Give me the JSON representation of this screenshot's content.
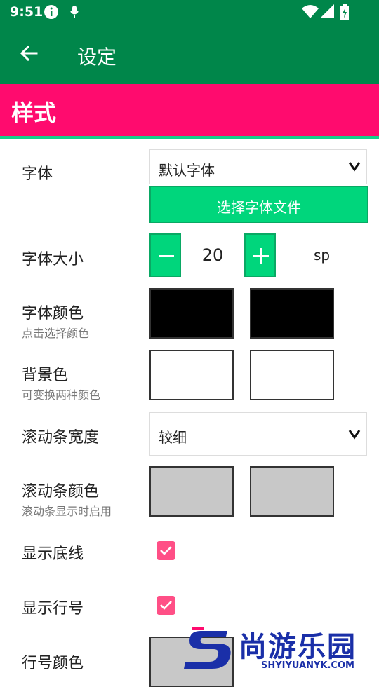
{
  "status_bar": {
    "time": "9:51"
  },
  "app_bar": {
    "title": "设定"
  },
  "section": {
    "title": "样式"
  },
  "font": {
    "label": "字体",
    "select_value": "默认字体",
    "choose_button": "选择字体文件"
  },
  "font_size": {
    "label": "字体大小",
    "value": "20",
    "unit": "sp"
  },
  "font_color": {
    "label": "字体颜色",
    "sublabel": "点击选择颜色",
    "colors": [
      "#000000",
      "#000000"
    ]
  },
  "bg_color": {
    "label": "背景色",
    "sublabel": "可变换两种颜色",
    "colors": [
      "#ffffff",
      "#ffffff"
    ]
  },
  "scrollbar_width": {
    "label": "滚动条宽度",
    "select_value": "较细"
  },
  "scrollbar_color": {
    "label": "滚动条颜色",
    "sublabel": "滚动条显示时启用",
    "colors": [
      "#c8c8c8",
      "#c8c8c8"
    ]
  },
  "show_underline": {
    "label": "显示底线",
    "checked": true
  },
  "show_line_numbers": {
    "label": "显示行号",
    "checked": true
  },
  "line_number_color": {
    "label": "行号颜色",
    "colors": [
      "#c8c8c8"
    ]
  },
  "watermark": {
    "text": "尚游乐园",
    "domain": "SHYIYUANYK.COM"
  },
  "theme": {
    "primary": "#00864a",
    "section": "#ff0b6e",
    "accent": "#00d67c",
    "checkbox": "#ff4f86"
  }
}
